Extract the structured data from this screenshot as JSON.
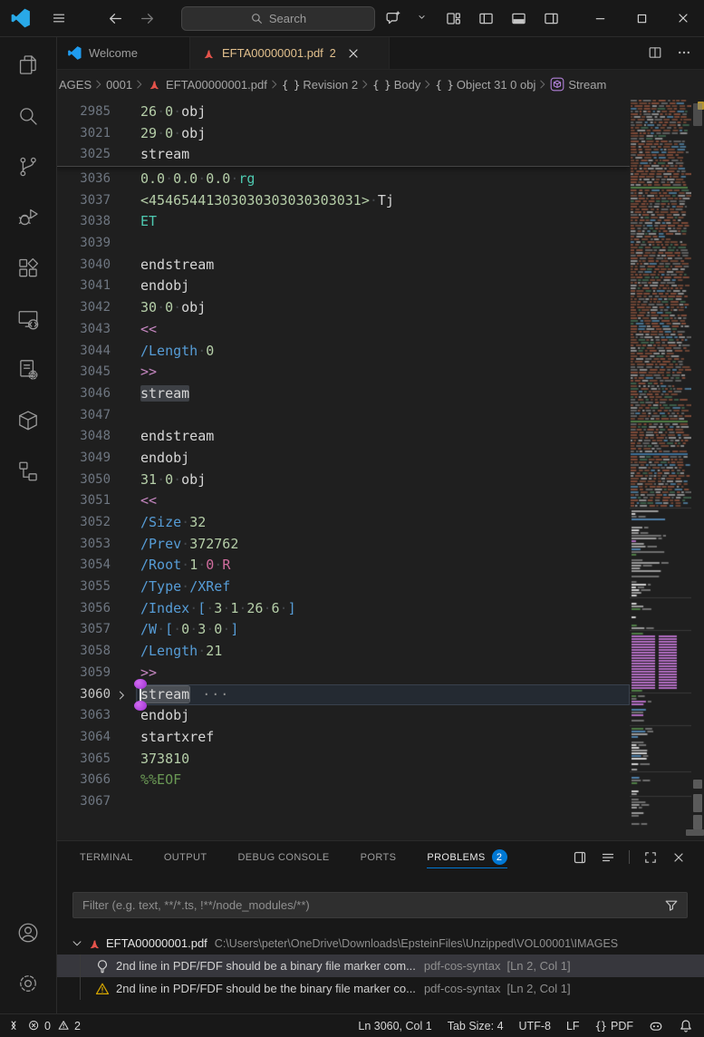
{
  "window": {
    "search_placeholder": "Search"
  },
  "colors": {
    "accent": "#0078d4",
    "tab_modified": "#e2c08d",
    "warning": "#d7a700",
    "pdf_red": "#e5534b",
    "symbol_purple": "#b180d7",
    "editor_bg": "#1f1f1f",
    "chrome_bg": "#181818"
  },
  "title_bar": {
    "action_icons": [
      "copilot-chat",
      "caret-down",
      "layout-grid",
      "sidebar-left",
      "panel-bottom",
      "sidebar-right"
    ],
    "window_controls": [
      "minimize",
      "maximize",
      "close"
    ]
  },
  "activity_bar": {
    "items": [
      "explorer",
      "search",
      "source-control",
      "run-debug",
      "extensions",
      "remote-explorer",
      "pdf-tools",
      "package",
      "hierarchy"
    ],
    "bottom": [
      "account",
      "settings"
    ]
  },
  "tabs": [
    {
      "label": "Welcome",
      "icon": "vscode",
      "active": false
    },
    {
      "label": "EFTA00000001.pdf",
      "icon": "pdf",
      "badge": "2",
      "active": true,
      "closable": true
    }
  ],
  "editor_actions": [
    "split-editor",
    "more-actions"
  ],
  "breadcrumb": [
    {
      "label": "AGES"
    },
    {
      "label": "0001"
    },
    {
      "label": "EFTA00000001.pdf",
      "icon": "pdf"
    },
    {
      "label": "Revision 2",
      "icon": "braces"
    },
    {
      "label": "Body",
      "icon": "braces"
    },
    {
      "label": "Object 31 0 obj",
      "icon": "braces"
    },
    {
      "label": "Stream",
      "icon": "cube"
    }
  ],
  "editor": {
    "fold_ellipsis": "···",
    "sticky": [
      {
        "n": "2985",
        "t": [
          [
            "26",
            "num"
          ],
          [
            "·",
            "ws"
          ],
          [
            "0",
            "num"
          ],
          [
            "·",
            "ws"
          ],
          [
            "obj",
            "plain"
          ]
        ]
      },
      {
        "n": "3021",
        "t": [
          [
            "29",
            "num"
          ],
          [
            "·",
            "ws"
          ],
          [
            "0",
            "num"
          ],
          [
            "·",
            "ws"
          ],
          [
            "obj",
            "plain"
          ]
        ]
      },
      {
        "n": "3025",
        "t": [
          [
            "stream",
            "plain"
          ]
        ]
      }
    ],
    "lines": [
      {
        "n": "3036",
        "t": [
          [
            "0.0",
            "num"
          ],
          [
            "·",
            "ws"
          ],
          [
            "0.0",
            "num"
          ],
          [
            "·",
            "ws"
          ],
          [
            "0.0",
            "num"
          ],
          [
            "·",
            "ws"
          ],
          [
            "rg",
            "op"
          ]
        ]
      },
      {
        "n": "3037",
        "t": [
          [
            "<45465441303030303030303031>",
            "str"
          ],
          [
            "·",
            "ws"
          ],
          [
            "Tj",
            "plain"
          ]
        ]
      },
      {
        "n": "3038",
        "t": [
          [
            "ET",
            "op"
          ]
        ]
      },
      {
        "n": "3039",
        "t": []
      },
      {
        "n": "3040",
        "t": [
          [
            "endstream",
            "plain"
          ]
        ]
      },
      {
        "n": "3041",
        "t": [
          [
            "endobj",
            "plain"
          ]
        ]
      },
      {
        "n": "3042",
        "t": [
          [
            "30",
            "num"
          ],
          [
            "·",
            "ws"
          ],
          [
            "0",
            "num"
          ],
          [
            "·",
            "ws"
          ],
          [
            "obj",
            "plain"
          ]
        ]
      },
      {
        "n": "3043",
        "t": [
          [
            "<<",
            "delim"
          ]
        ]
      },
      {
        "n": "3044",
        "t": [
          [
            "/Length",
            "name"
          ],
          [
            "·",
            "ws"
          ],
          [
            "0",
            "num"
          ]
        ]
      },
      {
        "n": "3045",
        "t": [
          [
            ">>",
            "delim"
          ]
        ]
      },
      {
        "n": "3046",
        "t": [
          [
            "stream",
            "plain",
            "box"
          ]
        ]
      },
      {
        "n": "3047",
        "t": []
      },
      {
        "n": "3048",
        "t": [
          [
            "endstream",
            "plain"
          ]
        ]
      },
      {
        "n": "3049",
        "t": [
          [
            "endobj",
            "plain"
          ]
        ]
      },
      {
        "n": "3050",
        "t": [
          [
            "31",
            "num"
          ],
          [
            "·",
            "ws"
          ],
          [
            "0",
            "num"
          ],
          [
            "·",
            "ws"
          ],
          [
            "obj",
            "plain"
          ]
        ]
      },
      {
        "n": "3051",
        "t": [
          [
            "<<",
            "delim"
          ]
        ]
      },
      {
        "n": "3052",
        "t": [
          [
            "/Size",
            "name"
          ],
          [
            "·",
            "ws"
          ],
          [
            "32",
            "num"
          ]
        ]
      },
      {
        "n": "3053",
        "t": [
          [
            "/Prev",
            "name"
          ],
          [
            "·",
            "ws"
          ],
          [
            "372762",
            "num"
          ]
        ]
      },
      {
        "n": "3054",
        "t": [
          [
            "/Root",
            "name"
          ],
          [
            "·",
            "ws"
          ],
          [
            "1",
            "num"
          ],
          [
            "·",
            "ws"
          ],
          [
            "0",
            "ref"
          ],
          [
            "·",
            "ws"
          ],
          [
            "R",
            "ref"
          ]
        ]
      },
      {
        "n": "3055",
        "t": [
          [
            "/Type",
            "name"
          ],
          [
            "·",
            "ws"
          ],
          [
            "/XRef",
            "name"
          ]
        ]
      },
      {
        "n": "3056",
        "t": [
          [
            "/Index",
            "name"
          ],
          [
            "·",
            "ws"
          ],
          [
            "[",
            "bracket"
          ],
          [
            "·",
            "ws"
          ],
          [
            "3",
            "num"
          ],
          [
            "·",
            "ws"
          ],
          [
            "1",
            "num"
          ],
          [
            "·",
            "ws"
          ],
          [
            "26",
            "num"
          ],
          [
            "·",
            "ws"
          ],
          [
            "6",
            "num"
          ],
          [
            "·",
            "ws"
          ],
          [
            "]",
            "bracket"
          ]
        ]
      },
      {
        "n": "3057",
        "t": [
          [
            "/W",
            "name"
          ],
          [
            "·",
            "ws"
          ],
          [
            "[",
            "bracket"
          ],
          [
            "·",
            "ws"
          ],
          [
            "0",
            "num"
          ],
          [
            "·",
            "ws"
          ],
          [
            "3",
            "num"
          ],
          [
            "·",
            "ws"
          ],
          [
            "0",
            "num"
          ],
          [
            "·",
            "ws"
          ],
          [
            "]",
            "bracket"
          ]
        ]
      },
      {
        "n": "3058",
        "t": [
          [
            "/Length",
            "name"
          ],
          [
            "·",
            "ws"
          ],
          [
            "21",
            "num"
          ]
        ]
      },
      {
        "n": "3059",
        "t": [
          [
            ">>",
            "delim"
          ]
        ],
        "dot": "below"
      },
      {
        "n": "3060",
        "t": [
          [
            "stream",
            "plain",
            "box2"
          ]
        ],
        "current": true,
        "fold": true,
        "ellipsis": true
      },
      {
        "n": "3063",
        "t": [
          [
            "endobj",
            "plain"
          ]
        ],
        "dot": "above"
      },
      {
        "n": "3064",
        "t": [
          [
            "startxref",
            "plain"
          ]
        ]
      },
      {
        "n": "3065",
        "t": [
          [
            "373810",
            "num"
          ]
        ]
      },
      {
        "n": "3066",
        "t": [
          [
            "%%EOF",
            "comment"
          ]
        ]
      },
      {
        "n": "3067",
        "t": []
      }
    ]
  },
  "panel": {
    "tabs": [
      {
        "label": "TERMINAL"
      },
      {
        "label": "OUTPUT"
      },
      {
        "label": "DEBUG CONSOLE"
      },
      {
        "label": "PORTS"
      },
      {
        "label": "PROBLEMS",
        "badge": "2",
        "active": true
      }
    ],
    "actions": [
      "notebook-layout",
      "view-lines",
      "separator",
      "maximize-panel",
      "close-panel"
    ],
    "filter_placeholder": "Filter (e.g. text, **/*.ts, !**/node_modules/**)",
    "file_row": {
      "name": "EFTA00000001.pdf",
      "path": "C:\\Users\\peter\\OneDrive\\Downloads\\EpsteinFiles\\Unzipped\\VOL00001\\IMAGES"
    },
    "problems": [
      {
        "severity": "hint",
        "message": "2nd line in PDF/FDF should be a binary file marker com...",
        "source": "pdf-cos-syntax",
        "location": "[Ln 2, Col 1]",
        "selected": true
      },
      {
        "severity": "warning",
        "message": "2nd line in PDF/FDF should be the binary file marker co...",
        "source": "pdf-cos-syntax",
        "location": "[Ln 2, Col 1]",
        "selected": false
      }
    ]
  },
  "status_bar": {
    "errors": "0",
    "warnings": "2",
    "right": [
      {
        "label": "Ln 3060, Col 1"
      },
      {
        "label": "Tab Size: 4"
      },
      {
        "label": "UTF-8"
      },
      {
        "label": "LF"
      },
      {
        "label": "PDF",
        "icon": "braces"
      },
      {
        "icon": "copilot-face"
      },
      {
        "icon": "bell"
      }
    ]
  }
}
